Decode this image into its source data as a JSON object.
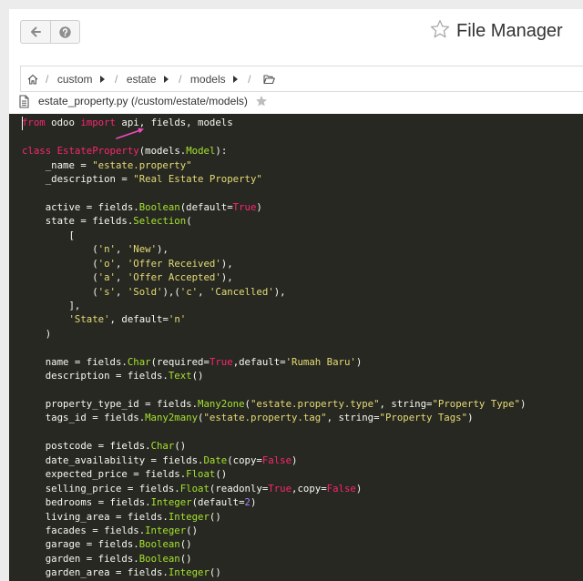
{
  "header": {
    "back_icon": "arrow-left-icon",
    "help_icon": "question-circle-icon",
    "favorite_icon": "star-outline-icon",
    "title": "File Manager"
  },
  "breadcrumb": {
    "home_icon": "home-icon",
    "separator": "/",
    "caret_icon": "caret-right-icon",
    "items": [
      "custom",
      "estate",
      "models"
    ],
    "folder_icon": "folder-open-icon"
  },
  "file": {
    "icon": "file-icon",
    "name": "estate_property.py",
    "path": "(/custom/estate/models)",
    "favorite_icon": "star-icon"
  },
  "editor": {
    "theme": {
      "background": "#272822",
      "text": "#f8f8f2",
      "cursor": "#f8f8f0"
    },
    "annotation_color": "#f04ac0",
    "annotation_icon": "arrow-icon",
    "lines": [
      [
        [
          "from",
          "#f92672"
        ],
        [
          " odoo "
        ],
        [
          "import",
          "#f92672"
        ],
        [
          " api, fields, models"
        ]
      ],
      [],
      [
        [
          "class",
          "#f92672"
        ],
        [
          " "
        ],
        [
          "EstateProperty",
          "#f92672"
        ],
        [
          "(models."
        ],
        [
          "Model",
          "#a6e22e"
        ],
        [
          "):"
        ]
      ],
      [
        [
          "    _name = "
        ],
        [
          "\"estate.property\"",
          "#e6db74"
        ]
      ],
      [
        [
          "    _description = "
        ],
        [
          "\"Real Estate Property\"",
          "#e6db74"
        ]
      ],
      [],
      [
        [
          "    active = fields."
        ],
        [
          "Boolean",
          "#a6e22e"
        ],
        [
          "(default="
        ],
        [
          "True",
          "#f92672"
        ],
        [
          ")"
        ]
      ],
      [
        [
          "    state = fields."
        ],
        [
          "Selection",
          "#a6e22e"
        ],
        [
          "("
        ]
      ],
      [
        [
          "        ["
        ]
      ],
      [
        [
          "            ("
        ],
        [
          "'n'",
          "#e6db74"
        ],
        [
          ", "
        ],
        [
          "'New'",
          "#e6db74"
        ],
        [
          "),"
        ]
      ],
      [
        [
          "            ("
        ],
        [
          "'o'",
          "#e6db74"
        ],
        [
          ", "
        ],
        [
          "'Offer Received'",
          "#e6db74"
        ],
        [
          "),"
        ]
      ],
      [
        [
          "            ("
        ],
        [
          "'a'",
          "#e6db74"
        ],
        [
          ", "
        ],
        [
          "'Offer Accepted'",
          "#e6db74"
        ],
        [
          "),"
        ]
      ],
      [
        [
          "            ("
        ],
        [
          "'s'",
          "#e6db74"
        ],
        [
          ", "
        ],
        [
          "'Sold'",
          "#e6db74"
        ],
        [
          "),("
        ],
        [
          "'c'",
          "#e6db74"
        ],
        [
          ", "
        ],
        [
          "'Cancelled'",
          "#e6db74"
        ],
        [
          "),"
        ]
      ],
      [
        [
          "        ],"
        ]
      ],
      [
        [
          "        "
        ],
        [
          "'State'",
          "#e6db74"
        ],
        [
          ", default="
        ],
        [
          "'n'",
          "#e6db74"
        ]
      ],
      [
        [
          "    )"
        ]
      ],
      [],
      [
        [
          "    name = fields."
        ],
        [
          "Char",
          "#a6e22e"
        ],
        [
          "(required="
        ],
        [
          "True",
          "#f92672"
        ],
        [
          ",default="
        ],
        [
          "'Rumah Baru'",
          "#e6db74"
        ],
        [
          ")"
        ]
      ],
      [
        [
          "    description = fields."
        ],
        [
          "Text",
          "#a6e22e"
        ],
        [
          "()"
        ]
      ],
      [],
      [
        [
          "    property_type_id = fields."
        ],
        [
          "Many2one",
          "#a6e22e"
        ],
        [
          "("
        ],
        [
          "\"estate.property.type\"",
          "#e6db74"
        ],
        [
          ", string="
        ],
        [
          "\"Property Type\"",
          "#e6db74"
        ],
        [
          ")"
        ]
      ],
      [
        [
          "    tags_id = fields."
        ],
        [
          "Many2many",
          "#a6e22e"
        ],
        [
          "("
        ],
        [
          "\"estate.property.tag\"",
          "#e6db74"
        ],
        [
          ", string="
        ],
        [
          "\"Property Tags\"",
          "#e6db74"
        ],
        [
          ")"
        ]
      ],
      [],
      [
        [
          "    postcode = fields."
        ],
        [
          "Char",
          "#a6e22e"
        ],
        [
          "()"
        ]
      ],
      [
        [
          "    date_availability = fields."
        ],
        [
          "Date",
          "#a6e22e"
        ],
        [
          "(copy="
        ],
        [
          "False",
          "#f92672"
        ],
        [
          ")"
        ]
      ],
      [
        [
          "    expected_price = fields."
        ],
        [
          "Float",
          "#a6e22e"
        ],
        [
          "()"
        ]
      ],
      [
        [
          "    selling_price = fields."
        ],
        [
          "Float",
          "#a6e22e"
        ],
        [
          "(readonly="
        ],
        [
          "True",
          "#f92672"
        ],
        [
          ",copy="
        ],
        [
          "False",
          "#f92672"
        ],
        [
          ")"
        ]
      ],
      [
        [
          "    bedrooms = fields."
        ],
        [
          "Integer",
          "#a6e22e"
        ],
        [
          "(default="
        ],
        [
          "2",
          "#ae81ff"
        ],
        [
          ")"
        ]
      ],
      [
        [
          "    living_area = fields."
        ],
        [
          "Integer",
          "#a6e22e"
        ],
        [
          "()"
        ]
      ],
      [
        [
          "    facades = fields."
        ],
        [
          "Integer",
          "#a6e22e"
        ],
        [
          "()"
        ]
      ],
      [
        [
          "    garage = fields."
        ],
        [
          "Boolean",
          "#a6e22e"
        ],
        [
          "()"
        ]
      ],
      [
        [
          "    garden = fields."
        ],
        [
          "Boolean",
          "#a6e22e"
        ],
        [
          "()"
        ]
      ],
      [
        [
          "    garden_area = fields."
        ],
        [
          "Integer",
          "#a6e22e"
        ],
        [
          "()"
        ]
      ]
    ]
  }
}
